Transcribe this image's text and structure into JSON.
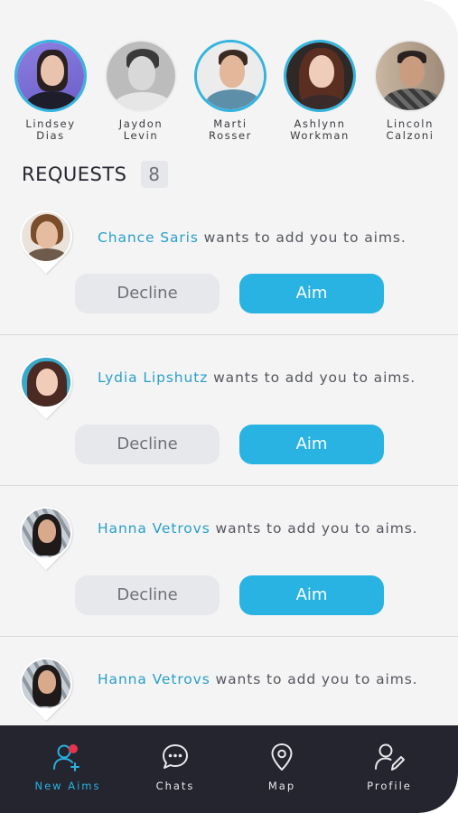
{
  "stories": [
    {
      "first": "Lindsey",
      "last": "Dias",
      "active": true
    },
    {
      "first": "Jaydon",
      "last": "Levin",
      "active": false
    },
    {
      "first": "Marti",
      "last": "Rosser",
      "active": true
    },
    {
      "first": "Ashlynn",
      "last": "Workman",
      "active": true
    },
    {
      "first": "Lincoln",
      "last": "Calzoni",
      "active": false
    }
  ],
  "requests_section": {
    "title": "REQUESTS",
    "count": "8"
  },
  "requests": [
    {
      "name": "Chance Saris",
      "message": " wants to add you to aims.",
      "decline_label": "Decline",
      "aim_label": "Aim"
    },
    {
      "name": "Lydia Lipshutz",
      "message": " wants to add you to aims.",
      "decline_label": "Decline",
      "aim_label": "Aim"
    },
    {
      "name": "Hanna Vetrovs",
      "message": " wants to add you to aims.",
      "decline_label": "Decline",
      "aim_label": "Aim"
    },
    {
      "name": "Hanna Vetrovs",
      "message": " wants to add you to aims."
    }
  ],
  "tabbar": {
    "tabs": [
      {
        "label": "New Aims",
        "icon": "user-plus-icon",
        "active": true
      },
      {
        "label": "Chats",
        "icon": "chat-bubble-icon",
        "active": false
      },
      {
        "label": "Map",
        "icon": "map-pin-icon",
        "active": false
      },
      {
        "label": "Profile",
        "icon": "user-edit-icon",
        "active": false
      }
    ]
  },
  "colors": {
    "accent": "#29b3e2",
    "tabbar": "#24252f",
    "notification": "#e8334a"
  }
}
